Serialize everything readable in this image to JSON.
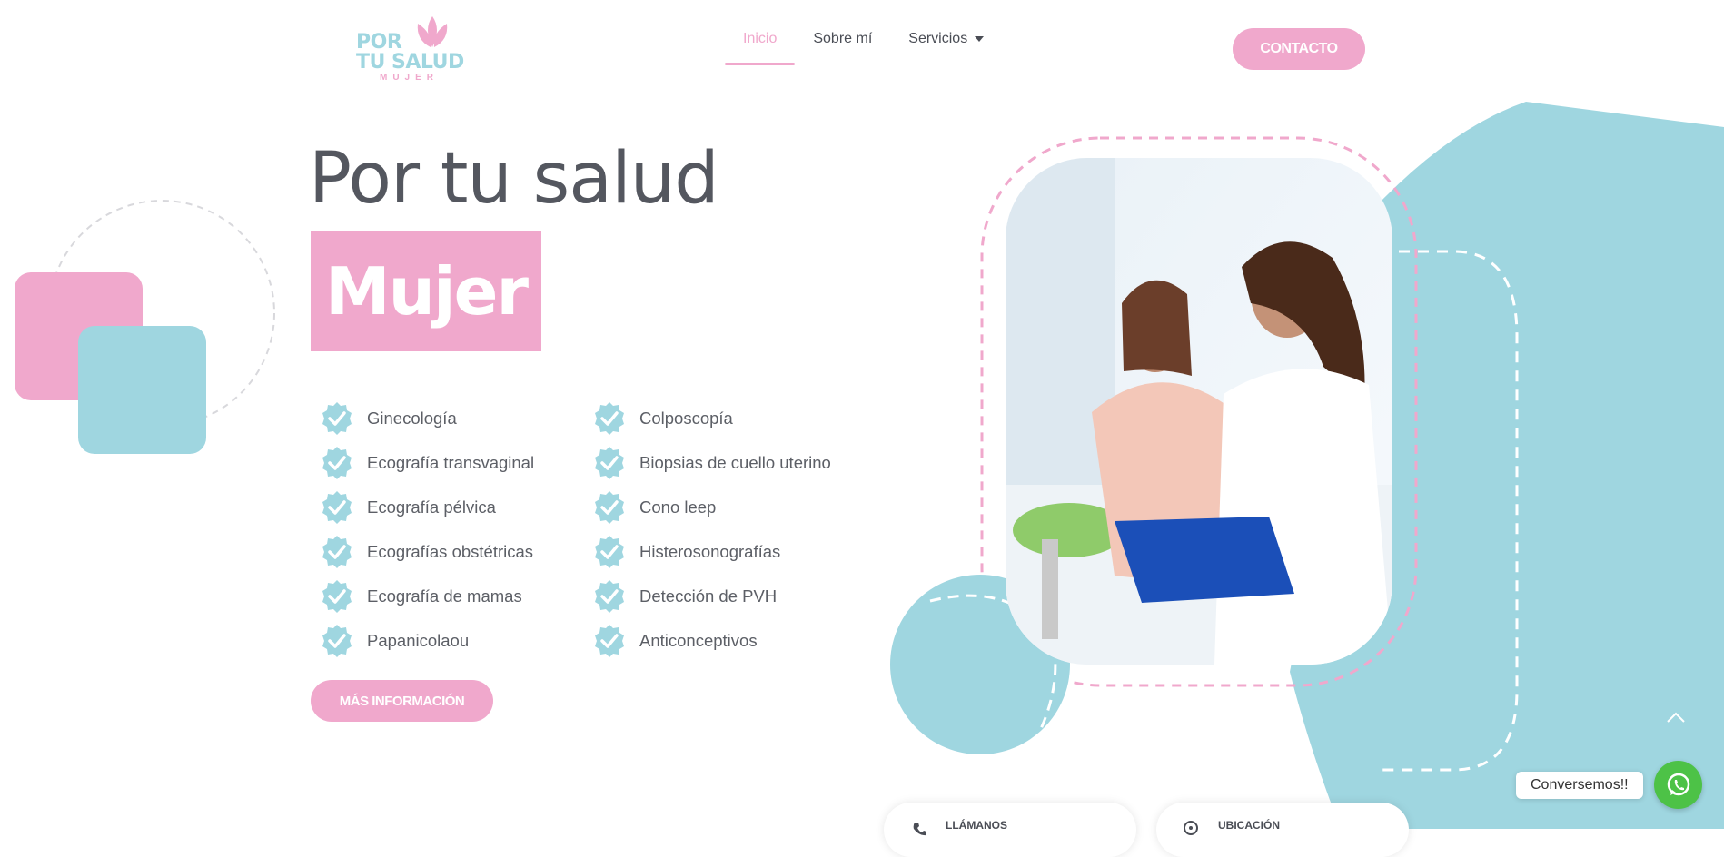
{
  "colors": {
    "pink": "#f0a8cc",
    "blue": "#9fd6e0",
    "text": "#54575f",
    "whatsapp": "#4dc247"
  },
  "logo": {
    "line1": "POR",
    "line2": "TU SALUD",
    "line3": "MUJER",
    "icon": "lotus-icon"
  },
  "nav": {
    "items": [
      {
        "label": "Inicio",
        "active": true
      },
      {
        "label": "Sobre mí",
        "active": false
      },
      {
        "label": "Servicios",
        "active": false,
        "icon": "chevron-down-icon"
      }
    ],
    "contact_label": "CONTACTO"
  },
  "hero": {
    "title": "Por tu salud",
    "highlight": "Mujer",
    "services_left": [
      "Ginecología",
      "Ecografía transvaginal",
      "Ecografía pélvica",
      "Ecografías obstétricas",
      "Ecografía de mamas",
      "Papanicolaou"
    ],
    "services_right": [
      "Colposcopía",
      "Biopsias de cuello uterino",
      "Cono leep",
      "Histerosonografías",
      "Detección de PVH",
      "Anticonceptivos"
    ],
    "more_label": "MÁS INFORMACIÓN",
    "check_icon": "check-badge-icon"
  },
  "cards": [
    {
      "label": "LLÁMANOS",
      "icon": "phone-icon"
    },
    {
      "label": "UBICACIÓN",
      "icon": "location-icon"
    }
  ],
  "chat": {
    "label": "Conversemos!!",
    "icon": "whatsapp-icon"
  },
  "scroll_top_icon": "chevron-up-icon"
}
